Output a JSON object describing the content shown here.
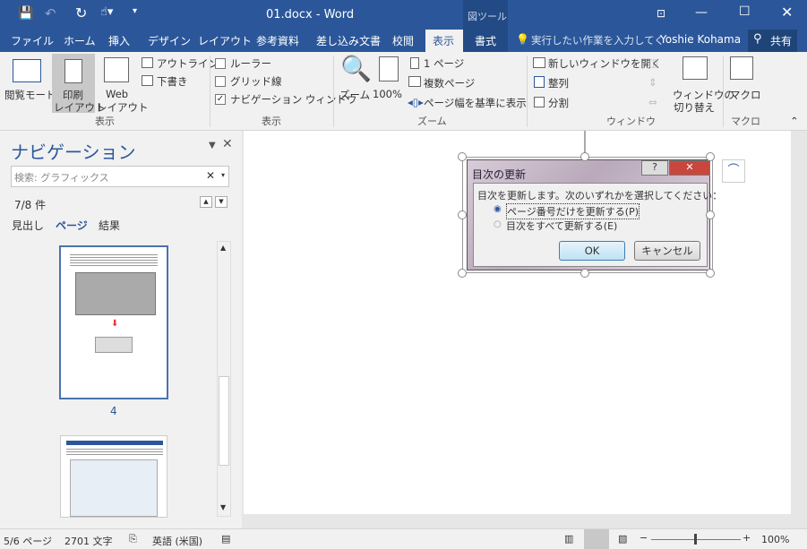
{
  "titlebar": {
    "title": "01.docx - Word",
    "context_tool": "図ツール",
    "qat": [
      "save-icon",
      "undo-icon",
      "redo-icon",
      "touch-mode-icon",
      "customize-icon"
    ],
    "window_controls": [
      "ribbon-display-icon",
      "minimize-icon",
      "maximize-icon",
      "close-icon"
    ]
  },
  "tabs": [
    {
      "label": "ファイル"
    },
    {
      "label": "ホーム"
    },
    {
      "label": "挿入"
    },
    {
      "label": "デザイン"
    },
    {
      "label": "レイアウト"
    },
    {
      "label": "参考資料"
    },
    {
      "label": "差し込み文書"
    },
    {
      "label": "校閲"
    },
    {
      "label": "表示",
      "active": true
    },
    {
      "label": "書式"
    }
  ],
  "tell_me": "実行したい作業を入力してく",
  "user": "Yoshie Kohama",
  "share": "共有",
  "ribbon": {
    "views": {
      "group": "表示",
      "read_mode": "閲覧モード",
      "print_layout_1": "印刷",
      "print_layout_2": "レイアウト",
      "web_1": "Web",
      "web_2": "レイアウト",
      "outline": "アウトライン",
      "draft": "下書き"
    },
    "show": {
      "group": "表示",
      "ruler": "ルーラー",
      "ruler_checked": false,
      "gridlines": "グリッド線",
      "gridlines_checked": false,
      "nav_pane": "ナビゲーション ウィンドウ",
      "nav_pane_checked": true
    },
    "zoom": {
      "group": "ズーム",
      "zoom": "ズーム",
      "hundred": "100%",
      "one_page": "1 ページ",
      "multi_page": "複数ページ",
      "page_width": "ページ幅を基準に表示"
    },
    "window": {
      "group": "ウィンドウ",
      "new_window": "新しいウィンドウを開く",
      "arrange": "整列",
      "split": "分割",
      "switch_1": "ウィンドウの",
      "switch_2": "切り替え"
    },
    "macros": {
      "group": "マクロ",
      "macro": "マクロ"
    }
  },
  "nav": {
    "title": "ナビゲーション",
    "search_value": "検索: グラフィックス",
    "result_count": "7/8 件",
    "tabs": [
      "見出し",
      "ページ",
      "結果"
    ],
    "active_tab": "ページ",
    "page_label": "4"
  },
  "dialog": {
    "title": "目次の更新",
    "prompt": "目次を更新します。次のいずれかを選択してください：",
    "option1": "ページ番号だけを更新する(P)",
    "option2": "目次をすべて更新する(E)",
    "selected": "option1",
    "ok": "OK",
    "cancel": "キャンセル"
  },
  "status": {
    "page": "5/6 ページ",
    "words": "2701 文字",
    "language": "英語 (米国)",
    "zoom": "100%"
  },
  "colors": {
    "accent": "#2b579a"
  }
}
